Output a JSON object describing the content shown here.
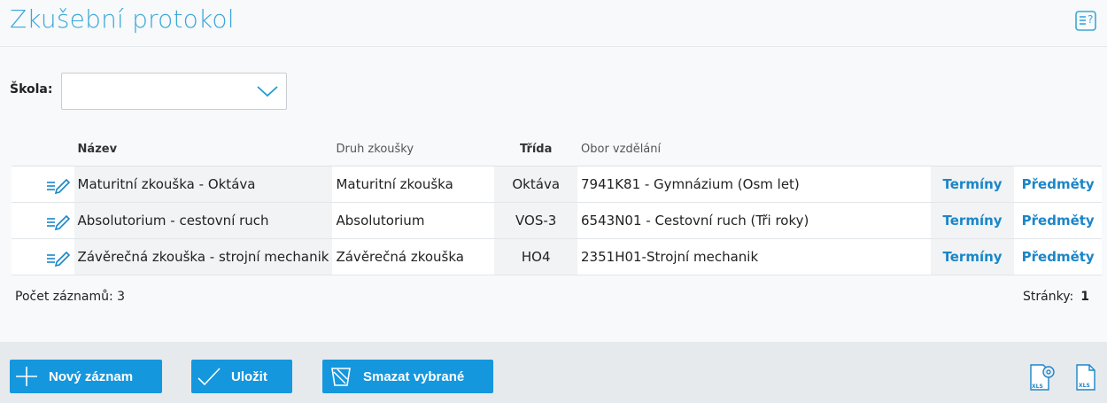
{
  "header": {
    "title": "Zkušební protokol"
  },
  "filter": {
    "label": "Škola:",
    "value": ""
  },
  "table": {
    "columns": {
      "name": "Název",
      "type": "Druh zkoušky",
      "class": "Třída",
      "field": "Obor vzdělání"
    },
    "rows": [
      {
        "name": "Maturitní zkouška - Oktáva",
        "type": "Maturitní zkouška",
        "class": "Oktáva",
        "field": "7941K81 - Gymnázium (Osm let)",
        "terms": "Termíny",
        "subjects": "Předměty"
      },
      {
        "name": "Absolutorium - cestovní ruch",
        "type": "Absolutorium",
        "class": "VOS-3",
        "field": "6543N01 - Cestovní ruch (Tři roky)",
        "terms": "Termíny",
        "subjects": "Předměty"
      },
      {
        "name": "Závěrečná zkouška - strojní mechanik",
        "type": "Závěrečná zkouška",
        "class": "HO4",
        "field": "2351H01-Strojní mechanik",
        "terms": "Termíny",
        "subjects": "Předměty"
      }
    ]
  },
  "summary": {
    "count_label": "Počet záznamů: 3",
    "pages_label": "Stránky:",
    "page": "1"
  },
  "footer": {
    "new_label": "Nový záznam",
    "save_label": "Uložit",
    "delete_label": "Smazat vybrané"
  },
  "colors": {
    "accent": "#1597de",
    "title": "#3aa7d6",
    "link": "#1a86c8"
  }
}
